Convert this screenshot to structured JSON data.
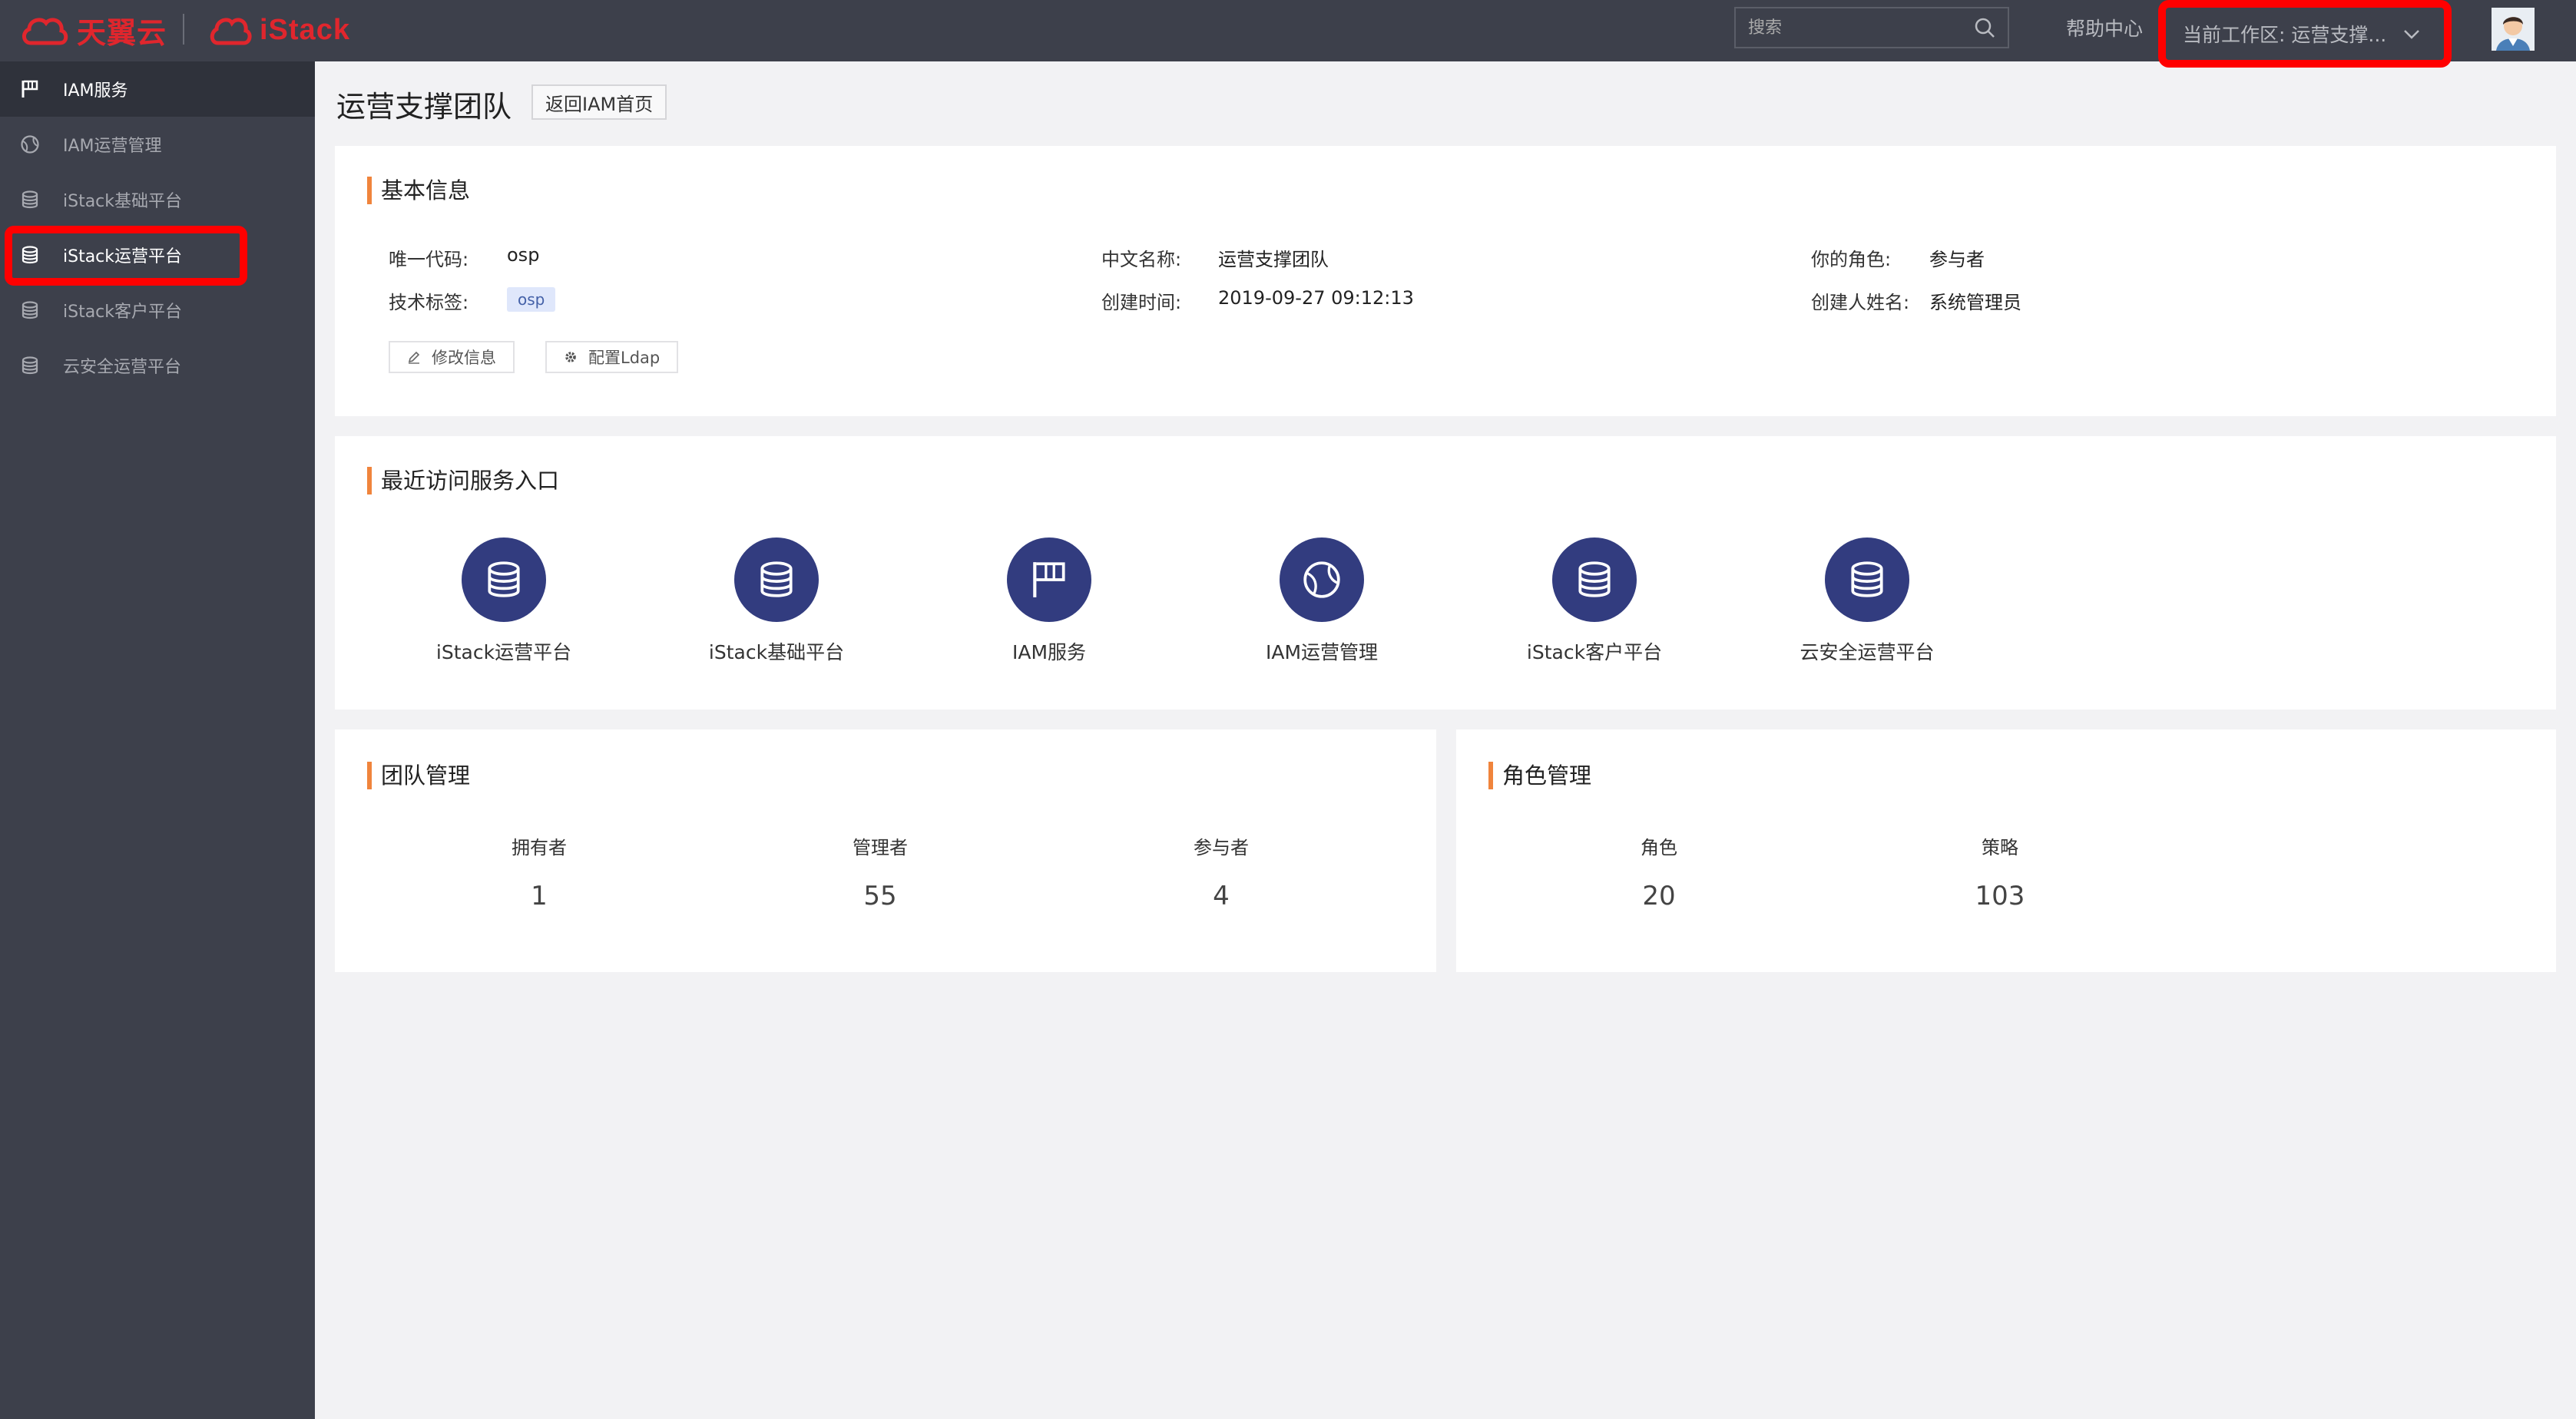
{
  "header": {
    "logo1_text": "天翼云",
    "logo2_text": "iStack",
    "search_placeholder": "搜索",
    "help_label": "帮助中心",
    "workspace_label": "当前工作区: 运营支撑..."
  },
  "sidebar": {
    "items": [
      {
        "label": "IAM服务",
        "icon": "flag-icon"
      },
      {
        "label": "IAM运营管理",
        "icon": "ball-icon"
      },
      {
        "label": "iStack基础平台",
        "icon": "database-icon"
      },
      {
        "label": "iStack运营平台",
        "icon": "database-icon"
      },
      {
        "label": "iStack客户平台",
        "icon": "database-icon"
      },
      {
        "label": "云安全运营平台",
        "icon": "database-icon"
      }
    ]
  },
  "page": {
    "title": "运营支撑团队",
    "back_label": "返回IAM首页"
  },
  "basic_info": {
    "title": "基本信息",
    "code_label": "唯一代码:",
    "code_value": "osp",
    "tag_label": "技术标签:",
    "tag_value": "osp",
    "cn_name_label": "中文名称:",
    "cn_name_value": "运营支撑团队",
    "created_label": "创建时间:",
    "created_value": "2019-09-27 09:12:13",
    "role_label": "你的角色:",
    "role_value": "参与者",
    "creator_label": "创建人姓名:",
    "creator_value": "系统管理员",
    "edit_label": "修改信息",
    "ldap_label": "配置Ldap"
  },
  "recent": {
    "title": "最近访问服务入口",
    "services": [
      {
        "label": "iStack运营平台",
        "icon": "database-icon"
      },
      {
        "label": "iStack基础平台",
        "icon": "database-icon"
      },
      {
        "label": "IAM服务",
        "icon": "flag-icon"
      },
      {
        "label": "IAM运营管理",
        "icon": "ball-icon"
      },
      {
        "label": "iStack客户平台",
        "icon": "database-icon"
      },
      {
        "label": "云安全运营平台",
        "icon": "database-icon"
      }
    ]
  },
  "team": {
    "title": "团队管理",
    "stats": [
      {
        "label": "拥有者",
        "value": "1"
      },
      {
        "label": "管理者",
        "value": "55"
      },
      {
        "label": "参与者",
        "value": "4"
      }
    ]
  },
  "roles": {
    "title": "角色管理",
    "stats": [
      {
        "label": "角色",
        "value": "20"
      },
      {
        "label": "策略",
        "value": "103"
      }
    ]
  },
  "colors": {
    "header_bg": "#3d404b",
    "accent_orange": "#f0843c",
    "service_circle": "#323c7f",
    "highlight_red": "#ff0000"
  }
}
